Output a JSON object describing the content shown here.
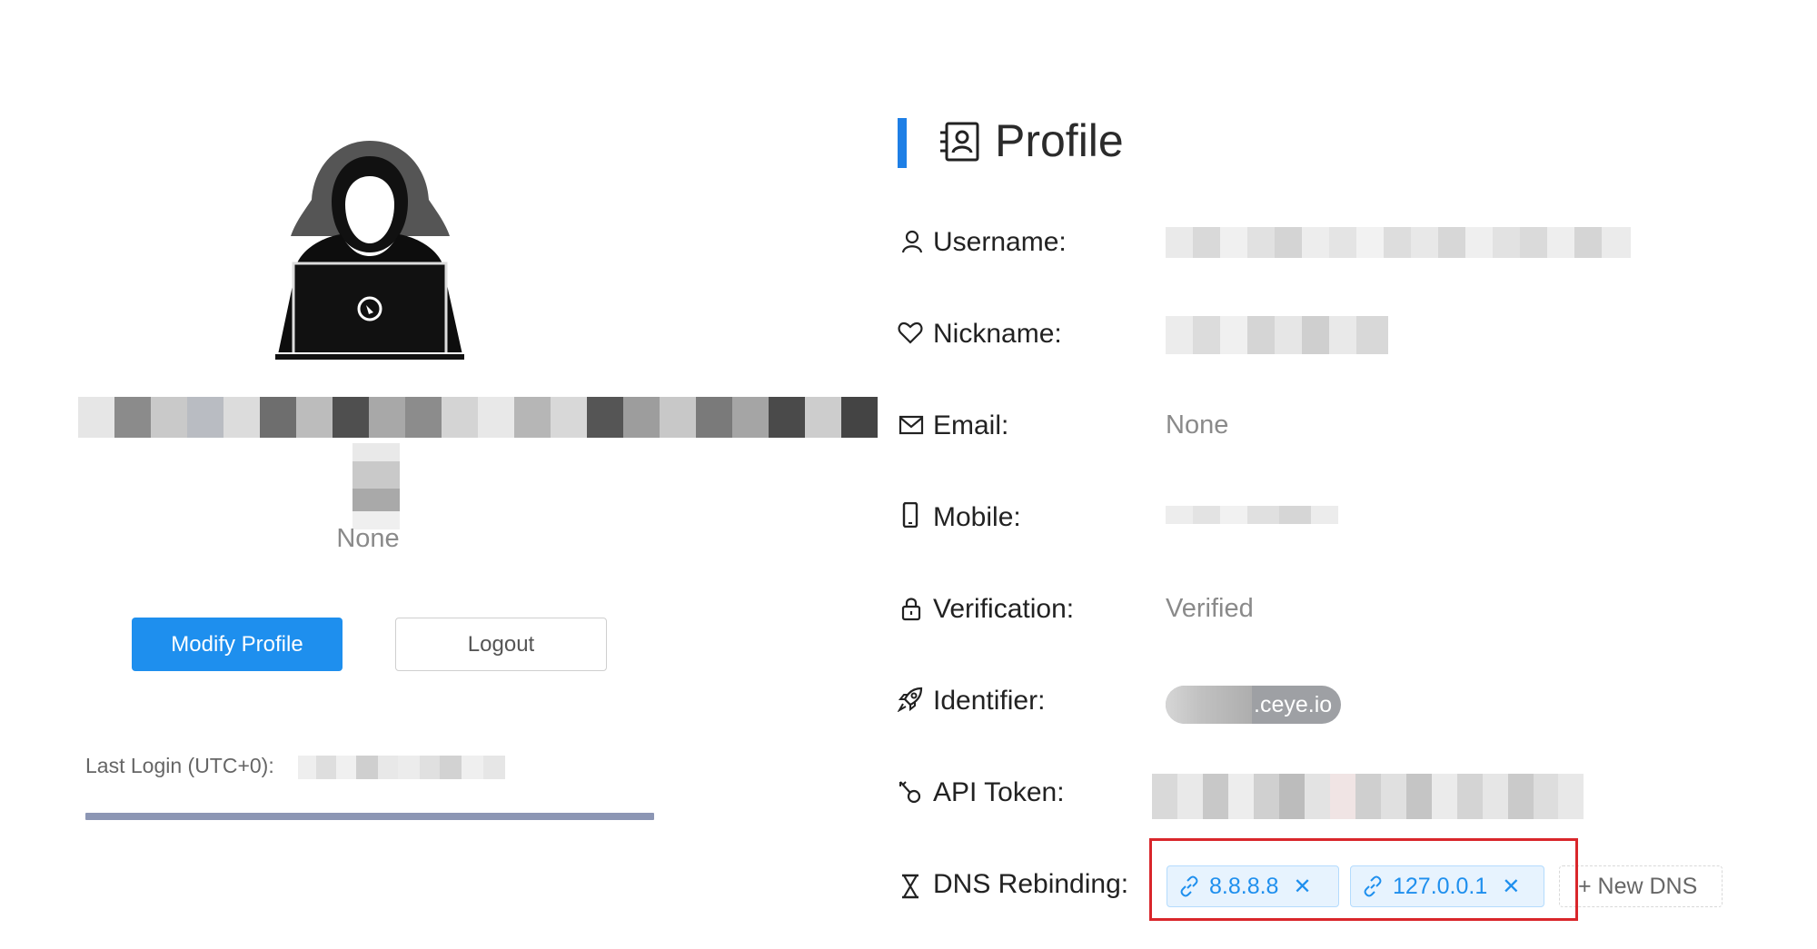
{
  "profile": {
    "title": "Profile",
    "left_nickname": "None",
    "modify_label": "Modify Profile",
    "logout_label": "Logout",
    "last_login_label": "Last Login (UTC+0):",
    "fields": {
      "username_label": "Username:",
      "nickname_label": "Nickname:",
      "email_label": "Email:",
      "email_value": "None",
      "mobile_label": "Mobile:",
      "verification_label": "Verification:",
      "verification_value": "Verified",
      "identifier_label": "Identifier:",
      "identifier_suffix": ".ceye.io",
      "api_token_label": "API Token:",
      "dns_rebinding_label": "DNS Rebinding:"
    },
    "dns_entries": [
      "8.8.8.8",
      "127.0.0.1"
    ],
    "new_dns_label": "+ New DNS"
  },
  "colors": {
    "primary": "#1e8fee",
    "title_accent": "#1e7fe6",
    "highlight": "#d9262b",
    "progress": "#8c96b4"
  },
  "icons": [
    "user-icon",
    "heart-icon",
    "mail-icon",
    "phone-icon",
    "lock-icon",
    "rocket-icon",
    "key-icon",
    "hourglass-icon",
    "link-icon",
    "contacts-book-icon"
  ]
}
